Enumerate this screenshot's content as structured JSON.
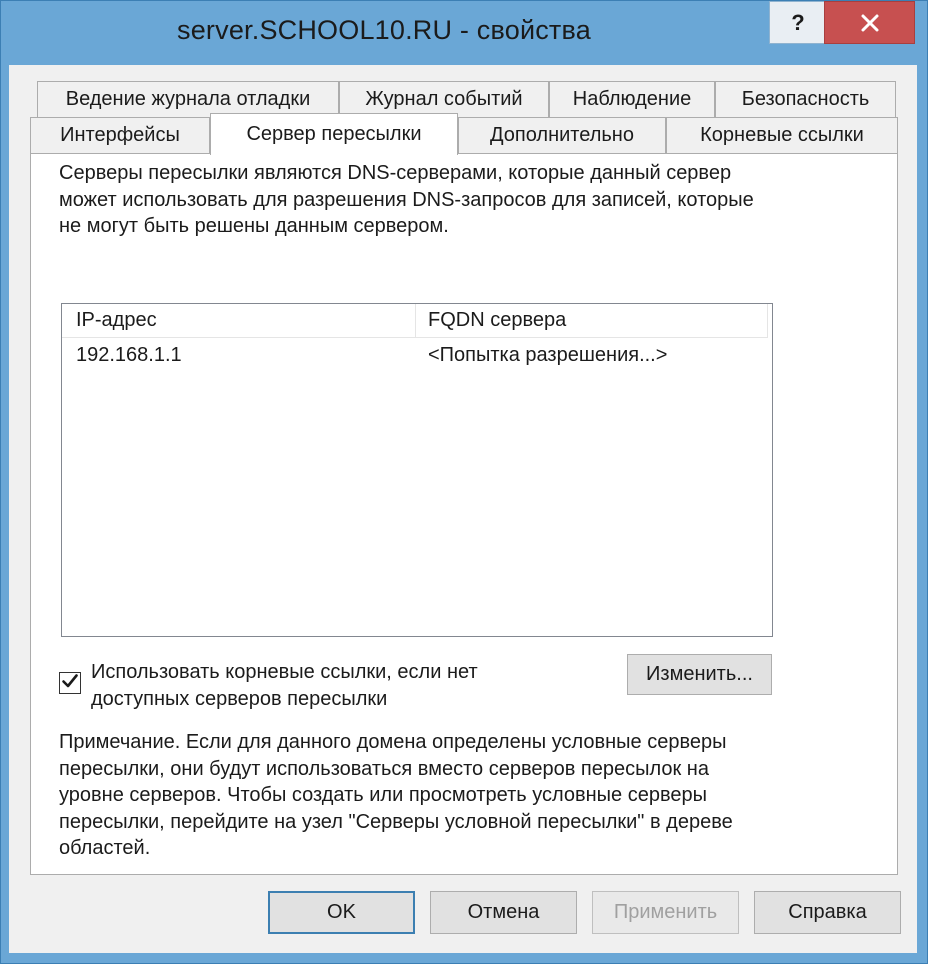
{
  "window": {
    "title": "server.SCHOOL10.RU - свойства",
    "help_label": "?",
    "close_label": "close"
  },
  "tabs_row1": [
    {
      "label": "Ведение журнала отладки"
    },
    {
      "label": "Журнал событий"
    },
    {
      "label": "Наблюдение"
    },
    {
      "label": "Безопасность"
    }
  ],
  "tabs_row2": [
    {
      "label": "Интерфейсы"
    },
    {
      "label": "Сервер пересылки",
      "active": true
    },
    {
      "label": "Дополнительно"
    },
    {
      "label": "Корневые ссылки"
    }
  ],
  "panel": {
    "description": "Серверы пересылки являются DNS-серверами, которые данный сервер может использовать для разрешения DNS-запросов для записей, которые не могут быть решены данным сервером.",
    "list": {
      "columns": [
        "IP-адрес",
        "FQDN сервера"
      ],
      "rows": [
        {
          "ip": "192.168.1.1",
          "fqdn": "<Попытка разрешения...>"
        }
      ]
    },
    "use_root_hints": {
      "checked": true,
      "label": "Использовать корневые ссылки, если нет доступных серверов пересылки"
    },
    "change_button": "Изменить...",
    "note": "Примечание. Если для данного домена определены условные серверы пересылки, они будут использоваться вместо серверов пересылок на уровне серверов.  Чтобы создать или просмотреть условные серверы пересылки, перейдите на узел \"Серверы условной пересылки\" в дереве областей."
  },
  "buttons": {
    "ok": "OK",
    "cancel": "Отмена",
    "apply": "Применить",
    "help": "Справка"
  },
  "colors": {
    "frame": "#6aa7d6",
    "close": "#c75050",
    "dialog_bg": "#f0f0f0"
  }
}
